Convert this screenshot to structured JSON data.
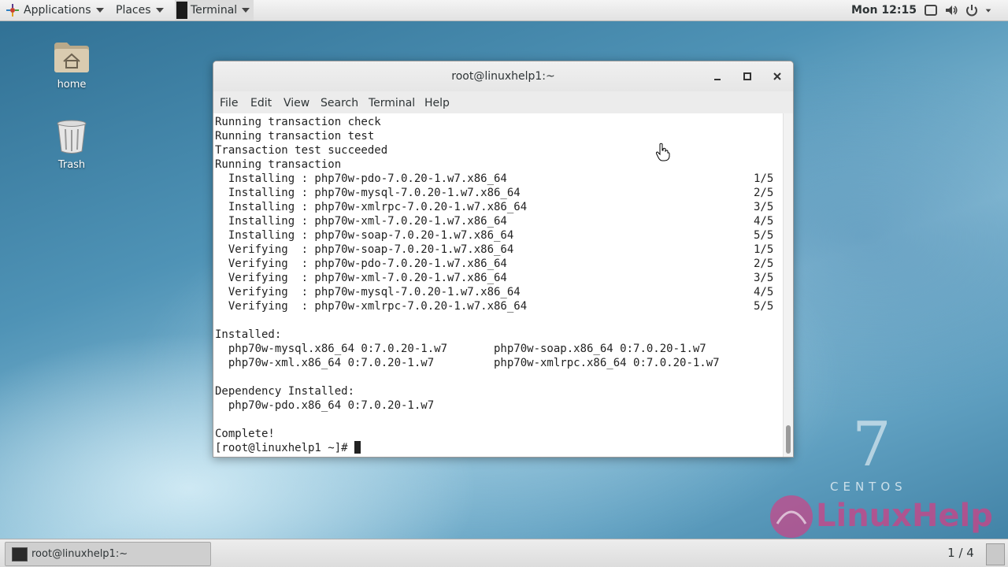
{
  "top_panel": {
    "applications_label": "Applications",
    "places_label": "Places",
    "terminal_app_label": "Terminal",
    "clock": "Mon 12:15",
    "status_icons": [
      "screen-icon",
      "volume-icon",
      "power-icon",
      "chevron-down-icon"
    ]
  },
  "desktop": {
    "icons": [
      {
        "label": "home",
        "icon": "home-folder-icon"
      },
      {
        "label": "Trash",
        "icon": "trash-icon"
      }
    ],
    "centos_number": "7",
    "centos_word": "CENTOS",
    "watermark_text": "LinuxHelp"
  },
  "window": {
    "title": "root@linuxhelp1:~",
    "buttons": [
      "minimize",
      "maximize",
      "close"
    ],
    "menu": [
      "File",
      "Edit",
      "View",
      "Search",
      "Terminal",
      "Help"
    ]
  },
  "terminal": {
    "lines": [
      {
        "text": "Running transaction check",
        "count": ""
      },
      {
        "text": "Running transaction test",
        "count": ""
      },
      {
        "text": "Transaction test succeeded",
        "count": ""
      },
      {
        "text": "Running transaction",
        "count": ""
      },
      {
        "text": "  Installing : php70w-pdo-7.0.20-1.w7.x86_64",
        "count": "1/5"
      },
      {
        "text": "  Installing : php70w-mysql-7.0.20-1.w7.x86_64",
        "count": "2/5"
      },
      {
        "text": "  Installing : php70w-xmlrpc-7.0.20-1.w7.x86_64",
        "count": "3/5"
      },
      {
        "text": "  Installing : php70w-xml-7.0.20-1.w7.x86_64",
        "count": "4/5"
      },
      {
        "text": "  Installing : php70w-soap-7.0.20-1.w7.x86_64",
        "count": "5/5"
      },
      {
        "text": "  Verifying  : php70w-soap-7.0.20-1.w7.x86_64",
        "count": "1/5"
      },
      {
        "text": "  Verifying  : php70w-pdo-7.0.20-1.w7.x86_64",
        "count": "2/5"
      },
      {
        "text": "  Verifying  : php70w-xml-7.0.20-1.w7.x86_64",
        "count": "3/5"
      },
      {
        "text": "  Verifying  : php70w-mysql-7.0.20-1.w7.x86_64",
        "count": "4/5"
      },
      {
        "text": "  Verifying  : php70w-xmlrpc-7.0.20-1.w7.x86_64",
        "count": "5/5"
      },
      {
        "text": "",
        "count": ""
      },
      {
        "text": "Installed:",
        "count": ""
      },
      {
        "text": "  php70w-mysql.x86_64 0:7.0.20-1.w7       php70w-soap.x86_64 0:7.0.20-1.w7",
        "count": ""
      },
      {
        "text": "  php70w-xml.x86_64 0:7.0.20-1.w7         php70w-xmlrpc.x86_64 0:7.0.20-1.w7",
        "count": ""
      },
      {
        "text": "",
        "count": ""
      },
      {
        "text": "Dependency Installed:",
        "count": ""
      },
      {
        "text": "  php70w-pdo.x86_64 0:7.0.20-1.w7",
        "count": ""
      },
      {
        "text": "",
        "count": ""
      },
      {
        "text": "Complete!",
        "count": ""
      }
    ],
    "prompt": "[root@linuxhelp1 ~]# "
  },
  "bottom_panel": {
    "task_label": "root@linuxhelp1:~",
    "workspace": "1 / 4"
  }
}
